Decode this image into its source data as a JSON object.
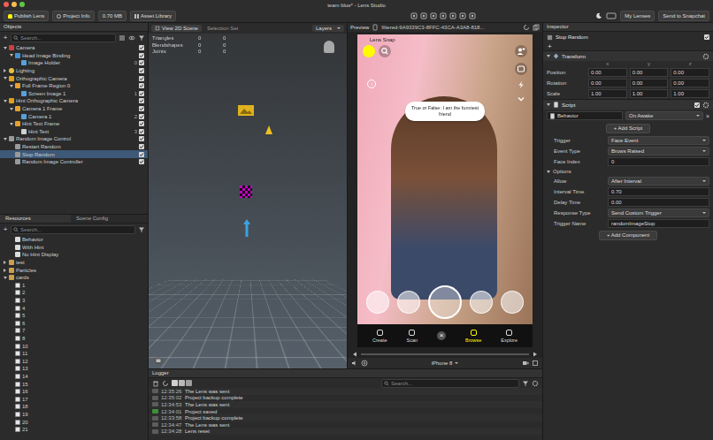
{
  "window": {
    "title": "team blue* - Lens Studio"
  },
  "toolbar": {
    "left": [
      "Publish Lens",
      "Project Info",
      "0.70 MB",
      "Asset Library"
    ],
    "right": [
      "My Lenses",
      "Send to Snapchat"
    ]
  },
  "objects": {
    "title": "Objects",
    "search": "Search...",
    "add": "+",
    "items": [
      {
        "label": "Camera",
        "depth": 0,
        "kind": "camera",
        "group": true,
        "expanded": true,
        "count": "",
        "checked": true,
        "selected": false
      },
      {
        "label": "Head Image Binding",
        "depth": 1,
        "kind": "binding",
        "group": true,
        "expanded": true,
        "count": "",
        "checked": true,
        "selected": false
      },
      {
        "label": "Image Holder",
        "depth": 2,
        "kind": "image",
        "group": false,
        "expanded": false,
        "count": "0",
        "checked": true,
        "selected": false
      },
      {
        "label": "Lighting",
        "depth": 0,
        "kind": "light",
        "group": true,
        "expanded": false,
        "count": "",
        "checked": true,
        "selected": false
      },
      {
        "label": "Orthographic Camera",
        "depth": 0,
        "kind": "ortho",
        "group": true,
        "expanded": true,
        "count": "",
        "checked": true,
        "selected": false
      },
      {
        "label": "Full Frame Region 0",
        "depth": 1,
        "kind": "region",
        "group": true,
        "expanded": true,
        "count": "",
        "checked": true,
        "selected": false
      },
      {
        "label": "Screen Image 1",
        "depth": 2,
        "kind": "image",
        "group": false,
        "expanded": false,
        "count": "1",
        "checked": true,
        "selected": false
      },
      {
        "label": "Hint Orthographic Camera",
        "depth": 0,
        "kind": "ortho",
        "group": true,
        "expanded": true,
        "count": "",
        "checked": true,
        "selected": false
      },
      {
        "label": "Camera 1 Frame",
        "depth": 1,
        "kind": "region",
        "group": true,
        "expanded": true,
        "count": "",
        "checked": true,
        "selected": false
      },
      {
        "label": "Camera 1",
        "depth": 2,
        "kind": "image",
        "group": false,
        "expanded": false,
        "count": "2",
        "checked": true,
        "selected": false
      },
      {
        "label": "Hint Text Frame",
        "depth": 1,
        "kind": "region",
        "group": true,
        "expanded": true,
        "count": "",
        "checked": true,
        "selected": false
      },
      {
        "label": "Hint Text",
        "depth": 2,
        "kind": "text",
        "group": false,
        "expanded": false,
        "count": "3",
        "checked": true,
        "selected": false
      },
      {
        "label": "Random Image Control",
        "depth": 0,
        "kind": "object",
        "group": true,
        "expanded": true,
        "count": "",
        "checked": true,
        "selected": false
      },
      {
        "label": "Restart Random",
        "depth": 1,
        "kind": "object",
        "group": false,
        "expanded": false,
        "count": "",
        "checked": true,
        "selected": false
      },
      {
        "label": "Stop Random",
        "depth": 1,
        "kind": "object",
        "group": false,
        "expanded": false,
        "count": "",
        "checked": true,
        "selected": true
      },
      {
        "label": "Random Image Controller",
        "depth": 1,
        "kind": "object",
        "group": false,
        "expanded": false,
        "count": "",
        "checked": true,
        "selected": false
      }
    ]
  },
  "resources": {
    "tabs": [
      {
        "label": "Resources",
        "selected": true
      },
      {
        "label": "Scene Config",
        "selected": false
      }
    ],
    "search": "Search...",
    "add": "+",
    "items": [
      {
        "label": "Behavior",
        "depth": 1,
        "kind": "script",
        "expanded": false
      },
      {
        "label": "With Hint",
        "depth": 1,
        "kind": "script",
        "expanded": false
      },
      {
        "label": "No Hint Display",
        "depth": 1,
        "kind": "script",
        "expanded": false
      },
      {
        "label": "test",
        "depth": 0,
        "kind": "folder",
        "expanded": false
      },
      {
        "label": "Particles",
        "depth": 0,
        "kind": "folder",
        "expanded": false
      },
      {
        "label": "cards",
        "depth": 0,
        "kind": "folder",
        "expanded": true
      },
      {
        "label": "1",
        "depth": 1,
        "kind": "texture",
        "expanded": false
      },
      {
        "label": "2",
        "depth": 1,
        "kind": "texture",
        "expanded": false
      },
      {
        "label": "3",
        "depth": 1,
        "kind": "texture",
        "expanded": false
      },
      {
        "label": "4",
        "depth": 1,
        "kind": "texture",
        "expanded": false
      },
      {
        "label": "5",
        "depth": 1,
        "kind": "texture",
        "expanded": false
      },
      {
        "label": "6",
        "depth": 1,
        "kind": "texture",
        "expanded": false
      },
      {
        "label": "7",
        "depth": 1,
        "kind": "texture",
        "expanded": false
      },
      {
        "label": "8",
        "depth": 1,
        "kind": "texture",
        "expanded": false
      },
      {
        "label": "10",
        "depth": 1,
        "kind": "texture",
        "expanded": false
      },
      {
        "label": "11",
        "depth": 1,
        "kind": "texture",
        "expanded": false
      },
      {
        "label": "12",
        "depth": 1,
        "kind": "texture",
        "expanded": false
      },
      {
        "label": "13",
        "depth": 1,
        "kind": "texture",
        "expanded": false
      },
      {
        "label": "14",
        "depth": 1,
        "kind": "texture",
        "expanded": false
      },
      {
        "label": "15",
        "depth": 1,
        "kind": "texture",
        "expanded": false
      },
      {
        "label": "16",
        "depth": 1,
        "kind": "texture",
        "expanded": false
      },
      {
        "label": "17",
        "depth": 1,
        "kind": "texture",
        "expanded": false
      },
      {
        "label": "18",
        "depth": 1,
        "kind": "texture",
        "expanded": false
      },
      {
        "label": "19",
        "depth": 1,
        "kind": "texture",
        "expanded": false
      },
      {
        "label": "20",
        "depth": 1,
        "kind": "texture",
        "expanded": false
      },
      {
        "label": "21",
        "depth": 1,
        "kind": "texture",
        "expanded": false
      }
    ]
  },
  "scene": {
    "tabs": [
      {
        "label": "View 2D Scene",
        "selected": true
      },
      {
        "label": "Selection Set",
        "selected": false
      }
    ],
    "layers": "Layers",
    "stats": [
      {
        "label": "Triangles",
        "values": [
          "0",
          "0"
        ]
      },
      {
        "label": "Blendshapes",
        "values": [
          "0",
          "0"
        ]
      },
      {
        "label": "Joints",
        "values": [
          "0",
          "0"
        ]
      }
    ]
  },
  "preview": {
    "title": "Preview",
    "file": "filtered-9A9339C3-8FFC-43CA-A3A8-818...",
    "status": "Lens Snap",
    "bubble": "True or False: I am the funniest friend",
    "info": "i",
    "close": "×",
    "lenses": [
      {
        "selected": false
      },
      {
        "selected": false
      },
      {
        "selected": true
      },
      {
        "selected": false
      },
      {
        "selected": false
      }
    ],
    "nav": [
      {
        "label": "Create",
        "selected": false
      },
      {
        "label": "Scan",
        "selected": false
      },
      {
        "label": "Browse",
        "selected": true
      },
      {
        "label": "Explore",
        "selected": false
      }
    ],
    "device": "iPhone 8"
  },
  "inspector": {
    "title": "Inspector",
    "object": {
      "name": "Stop Random",
      "enabled": true
    },
    "add": "+",
    "transform": {
      "title": "Transform",
      "axes": [
        "x",
        "y",
        "z"
      ],
      "rows": [
        {
          "label": "Position",
          "values": [
            "0.00",
            "0.00",
            "0.00"
          ]
        },
        {
          "label": "Rotation",
          "values": [
            "0.00",
            "0.00",
            "0.00"
          ]
        },
        {
          "label": "Scale",
          "values": [
            "1.00",
            "1.00",
            "1.00"
          ]
        }
      ]
    },
    "script": {
      "title": "Script",
      "enabled": true,
      "asset": "Behavior",
      "event": "On Awake",
      "remove": "×",
      "addScript": "+ Add Script",
      "fields": [
        {
          "label": "Trigger",
          "value": "Face Event",
          "kind": "dropdown"
        },
        {
          "label": "Event Type",
          "value": "Brows Raised",
          "kind": "dropdown"
        },
        {
          "label": "Face Index",
          "value": "0",
          "kind": "input"
        },
        {
          "label": "Options",
          "kind": "section",
          "expanded": true
        },
        {
          "label": "Allow",
          "value": "After Interval",
          "kind": "dropdown"
        },
        {
          "label": "Interval Time",
          "value": "0.70",
          "kind": "input"
        },
        {
          "label": "Delay Time",
          "value": "0.00",
          "kind": "input"
        },
        {
          "label": "Response Type",
          "value": "Send Custom Trigger",
          "kind": "dropdown"
        },
        {
          "label": "Trigger Name",
          "value": "randomImageStop",
          "kind": "input"
        }
      ]
    },
    "addComponent": "+ Add Component"
  },
  "logger": {
    "title": "Logger",
    "search": "Search...",
    "entries": [
      {
        "time": "12:35:26",
        "message": "The Lens was sent",
        "color": "#5c5c5c"
      },
      {
        "time": "12:35:02",
        "message": "Project backup complete",
        "color": "#5c5c5c"
      },
      {
        "time": "12:34:53",
        "message": "The Lens was sent",
        "color": "#5c5c5c"
      },
      {
        "time": "12:34:01",
        "message": "Project saved",
        "color": "#3f8f3a"
      },
      {
        "time": "12:33:58",
        "message": "Project backup complete",
        "color": "#5c5c5c"
      },
      {
        "time": "12:34:47",
        "message": "The Lens was sent",
        "color": "#5c5c5c"
      },
      {
        "time": "12:34:28",
        "message": "Lens reset",
        "color": "#5c5c5c"
      }
    ]
  }
}
